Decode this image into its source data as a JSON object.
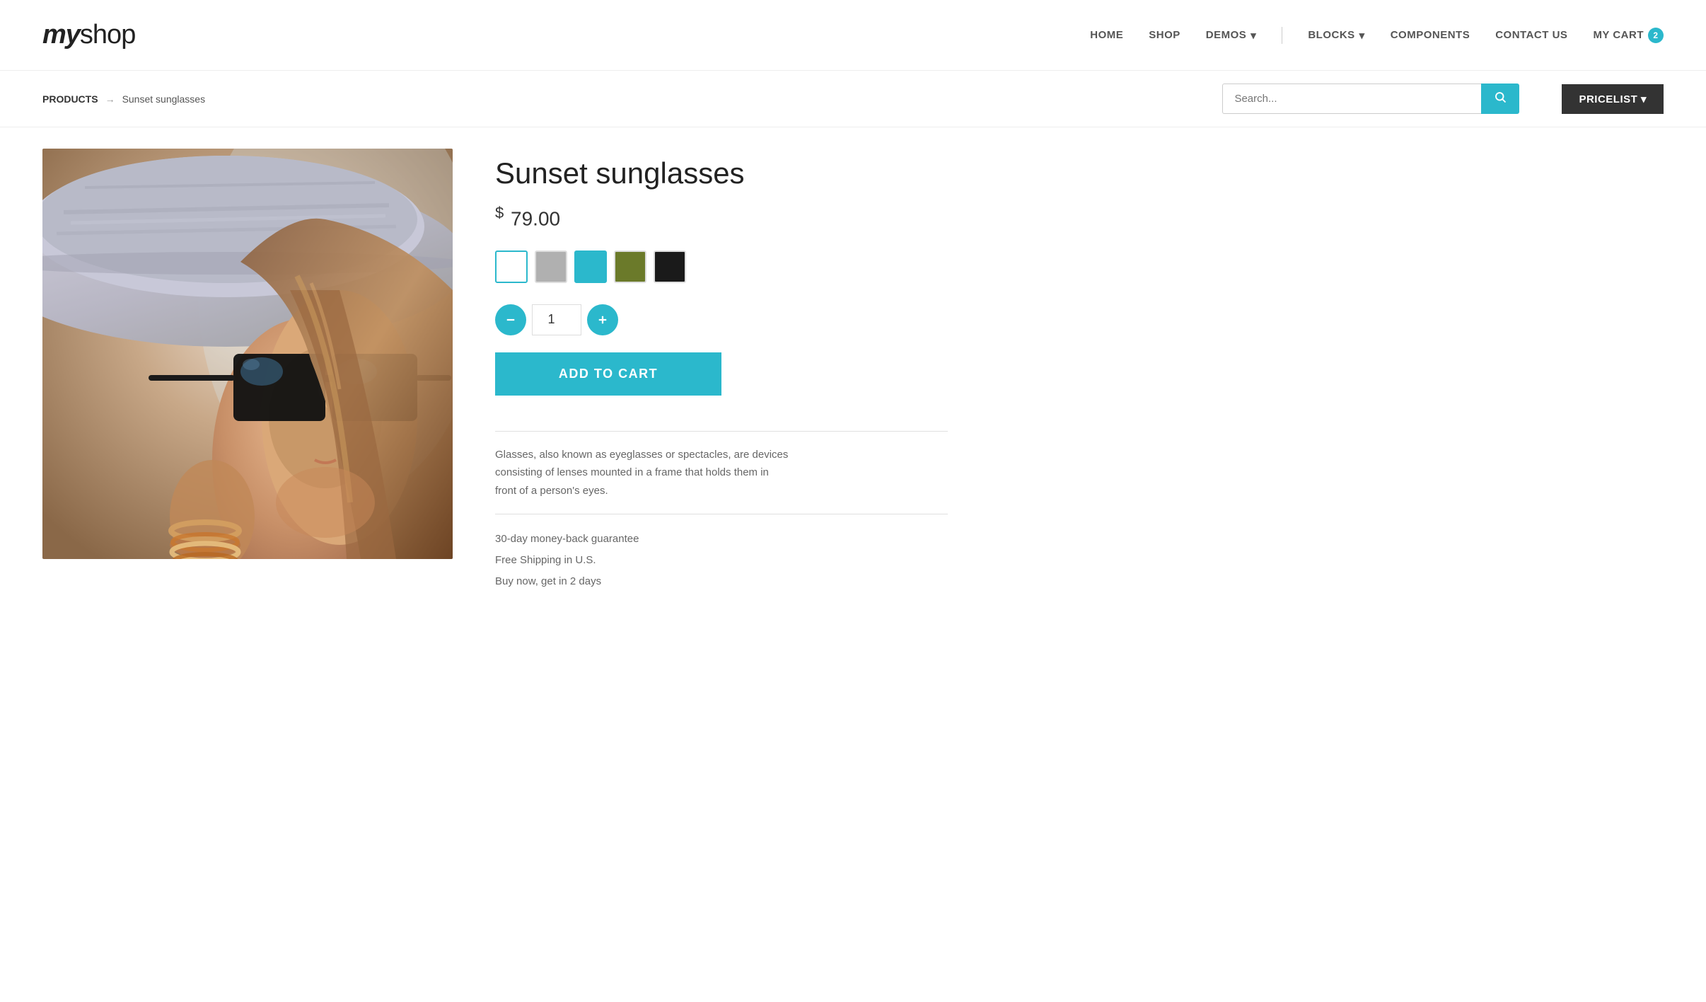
{
  "logo": {
    "text_bold": "my",
    "text_light": "shop"
  },
  "nav": {
    "items": [
      {
        "id": "home",
        "label": "HOME",
        "has_arrow": false,
        "has_divider_before": false
      },
      {
        "id": "shop",
        "label": "SHOP",
        "has_arrow": false,
        "has_divider_before": false
      },
      {
        "id": "demos",
        "label": "DEMOS",
        "has_arrow": true,
        "has_divider_before": false
      },
      {
        "id": "blocks",
        "label": "BLOCKS",
        "has_arrow": true,
        "has_divider_before": false
      },
      {
        "id": "components",
        "label": "COMPONENTS",
        "has_arrow": false,
        "has_divider_before": false
      },
      {
        "id": "contact",
        "label": "CONTACT US",
        "has_arrow": false,
        "has_divider_before": false
      },
      {
        "id": "cart",
        "label": "MY CART",
        "has_arrow": false,
        "has_divider_before": false,
        "badge": "2"
      }
    ]
  },
  "breadcrumb": {
    "root": "PRODUCTS",
    "separator": "→",
    "current": "Sunset sunglasses"
  },
  "search": {
    "placeholder": "Search..."
  },
  "pricelist": {
    "label": "PRICELIST ▾"
  },
  "product": {
    "title": "Sunset sunglasses",
    "price_symbol": "$",
    "price": "79.00",
    "colors": [
      {
        "id": "white",
        "label": "White",
        "class": "white",
        "selected": true
      },
      {
        "id": "gray",
        "label": "Gray",
        "class": "gray",
        "selected": false
      },
      {
        "id": "cyan",
        "label": "Cyan",
        "class": "cyan",
        "selected": false
      },
      {
        "id": "olive",
        "label": "Olive",
        "class": "olive",
        "selected": false
      },
      {
        "id": "black",
        "label": "Black",
        "class": "black",
        "selected": false
      }
    ],
    "quantity": "1",
    "add_to_cart_label": "ADD TO CART",
    "description": "Glasses, also known as eyeglasses or spectacles, are devices consisting of lenses mounted in a frame that holds them in front of a person's eyes.",
    "features": [
      "30-day money-back guarantee",
      "Free Shipping in U.S.",
      "Buy now, get in 2 days"
    ]
  }
}
